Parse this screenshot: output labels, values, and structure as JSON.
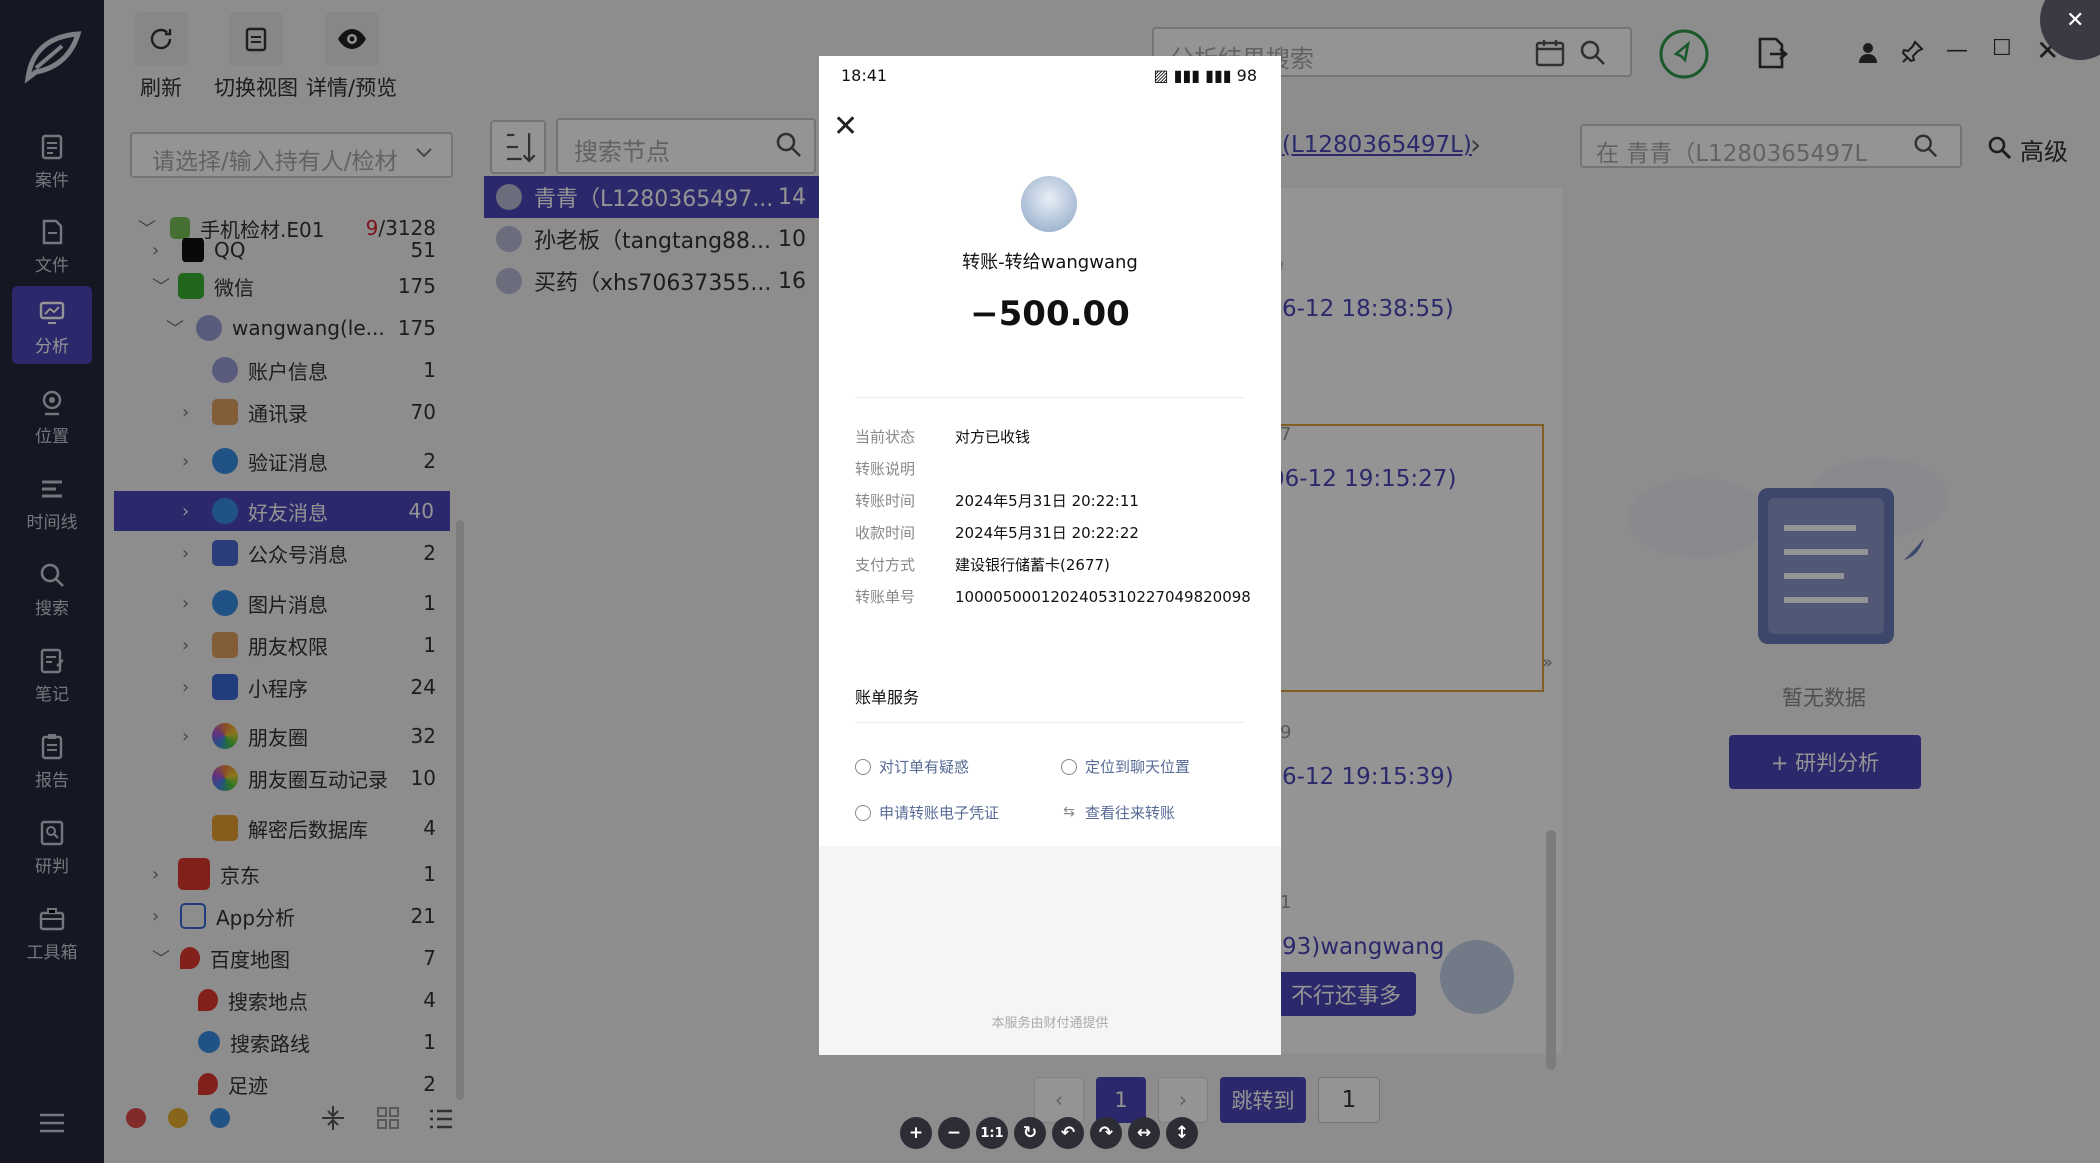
{
  "nav": {
    "items": [
      {
        "label": "案件"
      },
      {
        "label": "文件"
      },
      {
        "label": "分析"
      },
      {
        "label": "位置"
      },
      {
        "label": "时间线"
      },
      {
        "label": "搜索"
      },
      {
        "label": "笔记"
      },
      {
        "label": "报告"
      },
      {
        "label": "研判"
      },
      {
        "label": "工具箱"
      }
    ]
  },
  "toolbar": {
    "refresh_label": "刷新",
    "switch_view_label": "切换视图",
    "detail_label": "详情/预览"
  },
  "top_search": {
    "placeholder": "分析结果搜索"
  },
  "holder_select": {
    "placeholder": "请选择/输入持有人/检材"
  },
  "tree": {
    "root_label": "手机检材.E01",
    "root_count_hit": "9",
    "root_count_total": "/3128",
    "rows": [
      {
        "label": "QQ",
        "count": "51"
      },
      {
        "label": "微信",
        "count": "175"
      },
      {
        "label": "wangwang(le...",
        "count": "175"
      },
      {
        "label": "账户信息",
        "count": "1"
      },
      {
        "label": "通讯录",
        "count": "70"
      },
      {
        "label": "验证消息",
        "count": "2"
      },
      {
        "label": "好友消息",
        "count": "40"
      },
      {
        "label": "公众号消息",
        "count": "2"
      },
      {
        "label": "图片消息",
        "count": "1"
      },
      {
        "label": "朋友权限",
        "count": "1"
      },
      {
        "label": "小程序",
        "count": "24"
      },
      {
        "label": "朋友圈",
        "count": "32"
      },
      {
        "label": "朋友圈互动记录",
        "count": "10"
      },
      {
        "label": "解密后数据库",
        "count": "4"
      },
      {
        "label": "京东",
        "count": "1"
      },
      {
        "label": "App分析",
        "count": "21"
      },
      {
        "label": "百度地图",
        "count": "7"
      },
      {
        "label": "搜索地点",
        "count": "4"
      },
      {
        "label": "搜索路线",
        "count": "1"
      },
      {
        "label": "足迹",
        "count": "2"
      }
    ]
  },
  "node_search": {
    "placeholder": "搜索节点"
  },
  "contacts": [
    {
      "name": "青青（L1280365497...",
      "count": "14"
    },
    {
      "name": "孙老板（tangtang88...",
      "count": "10"
    },
    {
      "name": "买药（xhs70637355...",
      "count": "16"
    }
  ],
  "chat": {
    "breadcrumb": "(L1280365497L)",
    "search_placeholder": "在 青青（L1280365497L",
    "advanced_label": "高级",
    "ts1": "6-12 18:38:55)",
    "ts2": "06-12 19:15:27)",
    "ts3": "6-12 19:15:39)",
    "sender": "93)wangwang",
    "bubble": "不行还事多",
    "frag1": "7",
    "frag2": "9",
    "frag3": "1"
  },
  "right_panel": {
    "empty_text": "暂无数据",
    "analyze_button": "+ 研判分析"
  },
  "pagination": {
    "current": "1",
    "jump_label": "跳转到",
    "jump_value": "1"
  },
  "zoom": [
    "+",
    "−",
    "1:1",
    "↻",
    "↶",
    "↷",
    "↔",
    "↕"
  ],
  "phone": {
    "time": "18:41",
    "signal": "▨ ▮▮▮ ▮▮▮ 98",
    "title": "转账-转给wangwang",
    "amount": "−500.00",
    "details": [
      {
        "k": "当前状态",
        "v": "对方已收钱"
      },
      {
        "k": "转账说明",
        "v": ""
      },
      {
        "k": "转账时间",
        "v": "2024年5月31日 20:22:11"
      },
      {
        "k": "收款时间",
        "v": "2024年5月31日 20:22:22"
      },
      {
        "k": "支付方式",
        "v": "建设银行储蓄卡(2677)"
      },
      {
        "k": "转账单号",
        "v": "1000050001202405310227049820098"
      }
    ],
    "service_title": "账单服务",
    "services": [
      "对订单有疑惑",
      "定位到聊天位置",
      "申请转账电子凭证",
      "查看往来转账"
    ],
    "footnote": "本服务由财付通提供"
  },
  "colors": {
    "accent": "#4a46b8",
    "nav_bg": "#252a3d",
    "link": "#576b95"
  }
}
